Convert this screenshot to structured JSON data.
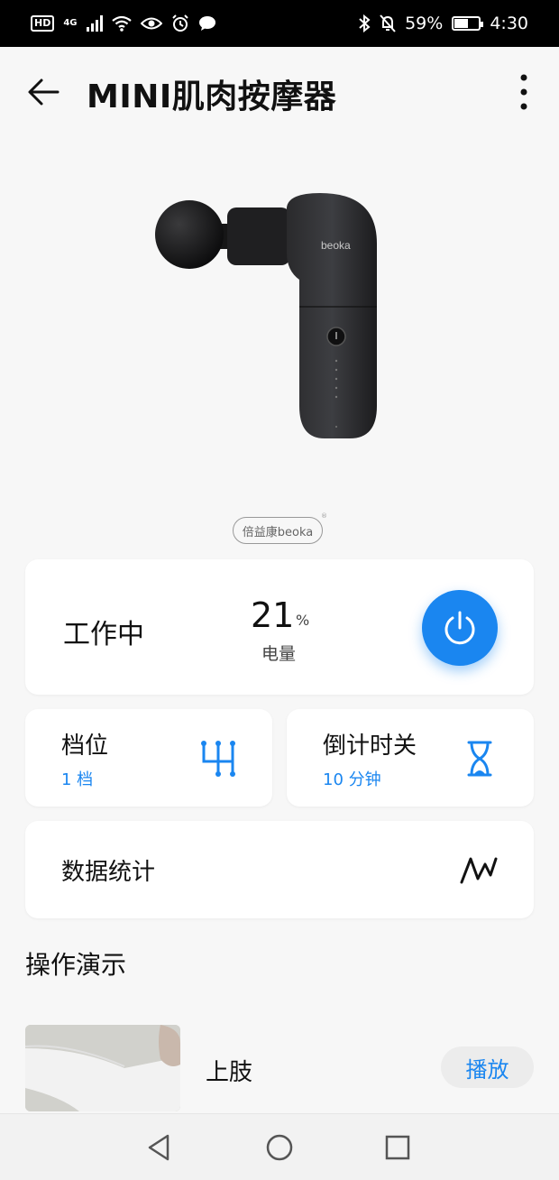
{
  "status_bar": {
    "hd": "HD",
    "network": "4G",
    "battery_pct": "59%",
    "battery_level": 0.59,
    "time": "4:30"
  },
  "header": {
    "title": "MINI肌肉按摩器"
  },
  "product": {
    "device_brand": "beoka",
    "logo_text": "倍益康beoka"
  },
  "status_card": {
    "state": "工作中",
    "battery_value": "21",
    "battery_unit": "%",
    "battery_label": "电量",
    "accent_color": "#1a86f0"
  },
  "gear_card": {
    "title": "档位",
    "value": "1 档",
    "icon": "gear-shift-icon"
  },
  "timer_card": {
    "title": "倒计时关",
    "value": "10 分钟",
    "icon": "hourglass-icon"
  },
  "stats_card": {
    "title": "数据统计",
    "icon": "trend-chart-icon"
  },
  "demo_section": {
    "title": "操作演示",
    "items": [
      {
        "label": "上肢",
        "action": "播放"
      }
    ]
  }
}
